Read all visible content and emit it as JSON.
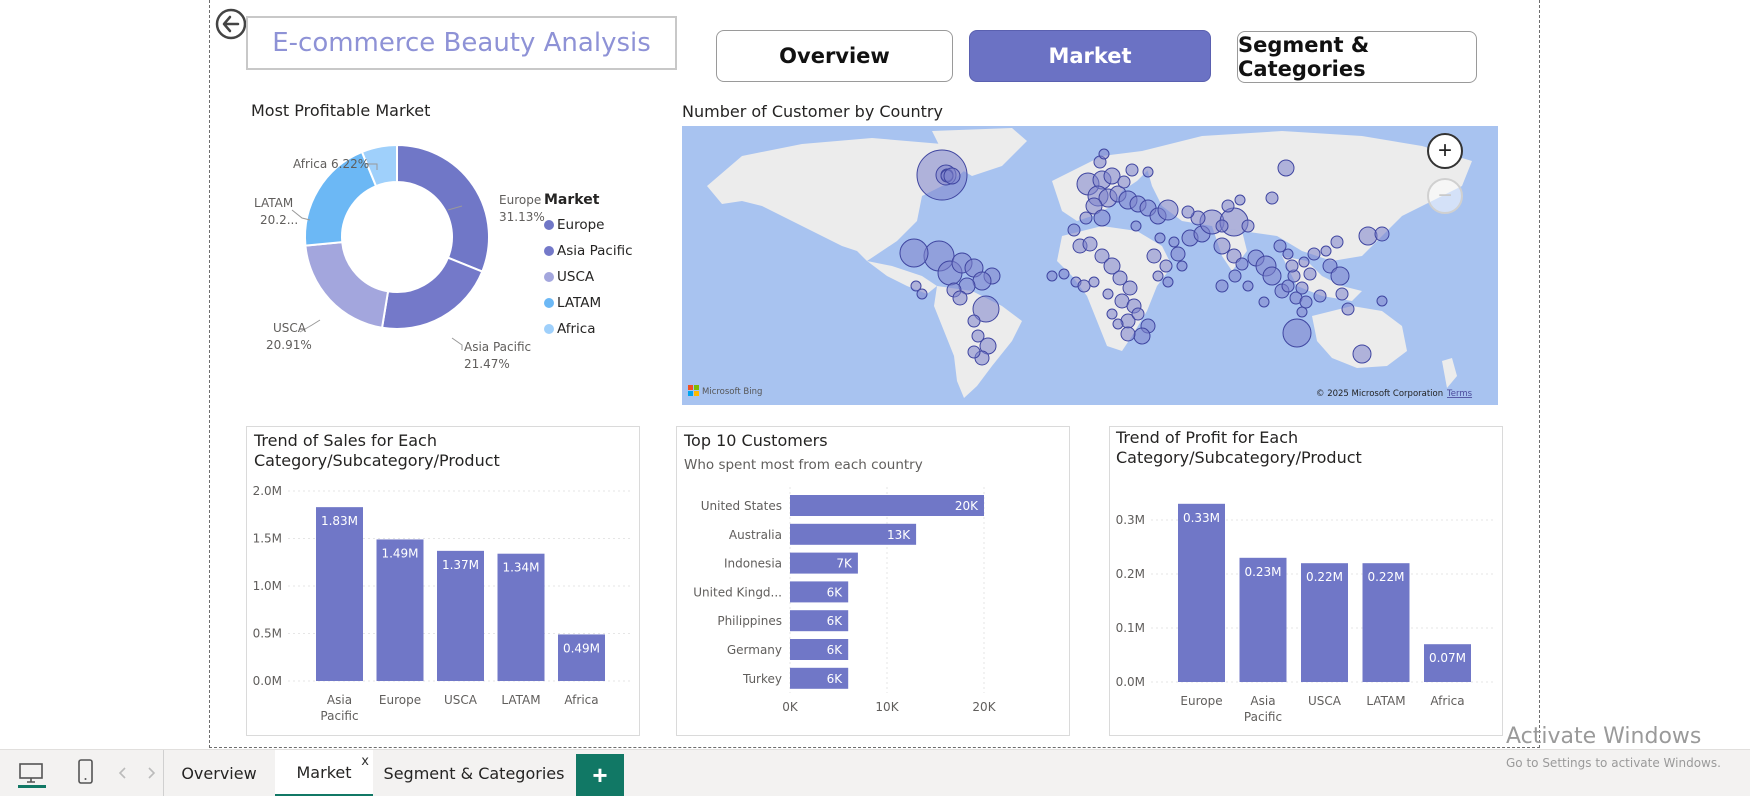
{
  "header": {
    "report_title": "E-commerce Beauty Analysis",
    "nav_buttons": {
      "overview": "Overview",
      "market": "Market",
      "segment": "Segment & Categories"
    }
  },
  "colors": {
    "accent": "#6b72c4",
    "bar": "#7077c7",
    "map_water": "#a8c3f0",
    "map_land": "#ececec",
    "bubble": "#7d84cc",
    "tab_accent": "#117865"
  },
  "donut": {
    "title": "Most Profitable Market",
    "legend_title": "Market",
    "legend": [
      "Europe",
      "Asia Pacific",
      "USCA",
      "LATAM",
      "Africa"
    ],
    "labels": {
      "europe": [
        "Europe",
        "31.13%"
      ],
      "asia": [
        "Asia Pacific",
        "21.47%"
      ],
      "usca": [
        "USCA",
        "20.91%"
      ],
      "latam": [
        "LATAM",
        "20.2..."
      ],
      "africa": "Africa 6.22%"
    }
  },
  "map": {
    "title": "Number of Customer by Country",
    "zoom_in": "+",
    "zoom_out": "−",
    "bing": "Microsoft Bing",
    "copyright": "© 2025 Microsoft Corporation",
    "terms": "Terms"
  },
  "sales_chart": {
    "title_line1": "Trend of Sales for Each",
    "title_line2": "Category/Subcategory/Product",
    "yticks": [
      "2.0M",
      "1.5M",
      "1.0M",
      "0.5M",
      "0.0M"
    ],
    "categories": [
      [
        "Asia",
        "Pacific"
      ],
      [
        "Europe"
      ],
      [
        "USCA"
      ],
      [
        "LATAM"
      ],
      [
        "Africa"
      ]
    ],
    "labels": [
      "1.83M",
      "1.49M",
      "1.37M",
      "1.34M",
      "0.49M"
    ]
  },
  "customers_chart": {
    "title": "Top 10 Customers",
    "subtitle": "Who spent most from each country",
    "countries": [
      "United States",
      "Australia",
      "Indonesia",
      "United Kingd...",
      "Philippines",
      "Germany",
      "Turkey"
    ],
    "labels": [
      "20K",
      "13K",
      "7K",
      "6K",
      "6K",
      "6K",
      "6K"
    ],
    "xticks": [
      "0K",
      "10K",
      "20K"
    ]
  },
  "profit_chart": {
    "title_line1": "Trend of Profit for Each",
    "title_line2": "Category/Subcategory/Product",
    "yticks": [
      "0.3M",
      "0.2M",
      "0.1M",
      "0.0M"
    ],
    "categories": [
      [
        "Europe"
      ],
      [
        "Asia",
        "Pacific"
      ],
      [
        "USCA"
      ],
      [
        "LATAM"
      ],
      [
        "Africa"
      ]
    ],
    "labels": [
      "0.33M",
      "0.23M",
      "0.22M",
      "0.22M",
      "0.07M"
    ]
  },
  "chart_data": [
    {
      "type": "pie",
      "title": "Most Profitable Market",
      "categories": [
        "Europe",
        "Asia Pacific",
        "USCA",
        "LATAM",
        "Africa"
      ],
      "values": [
        31.13,
        21.47,
        20.91,
        20.27,
        6.22
      ]
    },
    {
      "type": "bar",
      "title": "Trend of Sales for Each Category/Subcategory/Product",
      "categories": [
        "Asia Pacific",
        "Europe",
        "USCA",
        "LATAM",
        "Africa"
      ],
      "values": [
        1.83,
        1.49,
        1.37,
        1.34,
        0.49
      ],
      "ylim": [
        0,
        2.0
      ],
      "unit": "M"
    },
    {
      "type": "bar",
      "orientation": "horizontal",
      "title": "Top 10 Customers",
      "subtitle": "Who spent most from each country",
      "categories": [
        "United States",
        "Australia",
        "Indonesia",
        "United Kingd...",
        "Philippines",
        "Germany",
        "Turkey"
      ],
      "values": [
        20,
        13,
        7,
        6,
        6,
        6,
        6
      ],
      "xlim": [
        0,
        20
      ],
      "unit": "K"
    },
    {
      "type": "bar",
      "title": "Trend of Profit for Each Category/Subcategory/Product",
      "categories": [
        "Europe",
        "Asia Pacific",
        "USCA",
        "LATAM",
        "Africa"
      ],
      "values": [
        0.33,
        0.23,
        0.22,
        0.22,
        0.07
      ],
      "ylim": [
        0,
        0.3
      ],
      "unit": "M"
    }
  ],
  "bottom_tabs": {
    "tabs": [
      "Overview",
      "Market",
      "Segment & Categories"
    ],
    "close": "x",
    "add": "+"
  },
  "watermark": {
    "line1": "Activate Windows",
    "line2": "Go to Settings to activate Windows."
  }
}
